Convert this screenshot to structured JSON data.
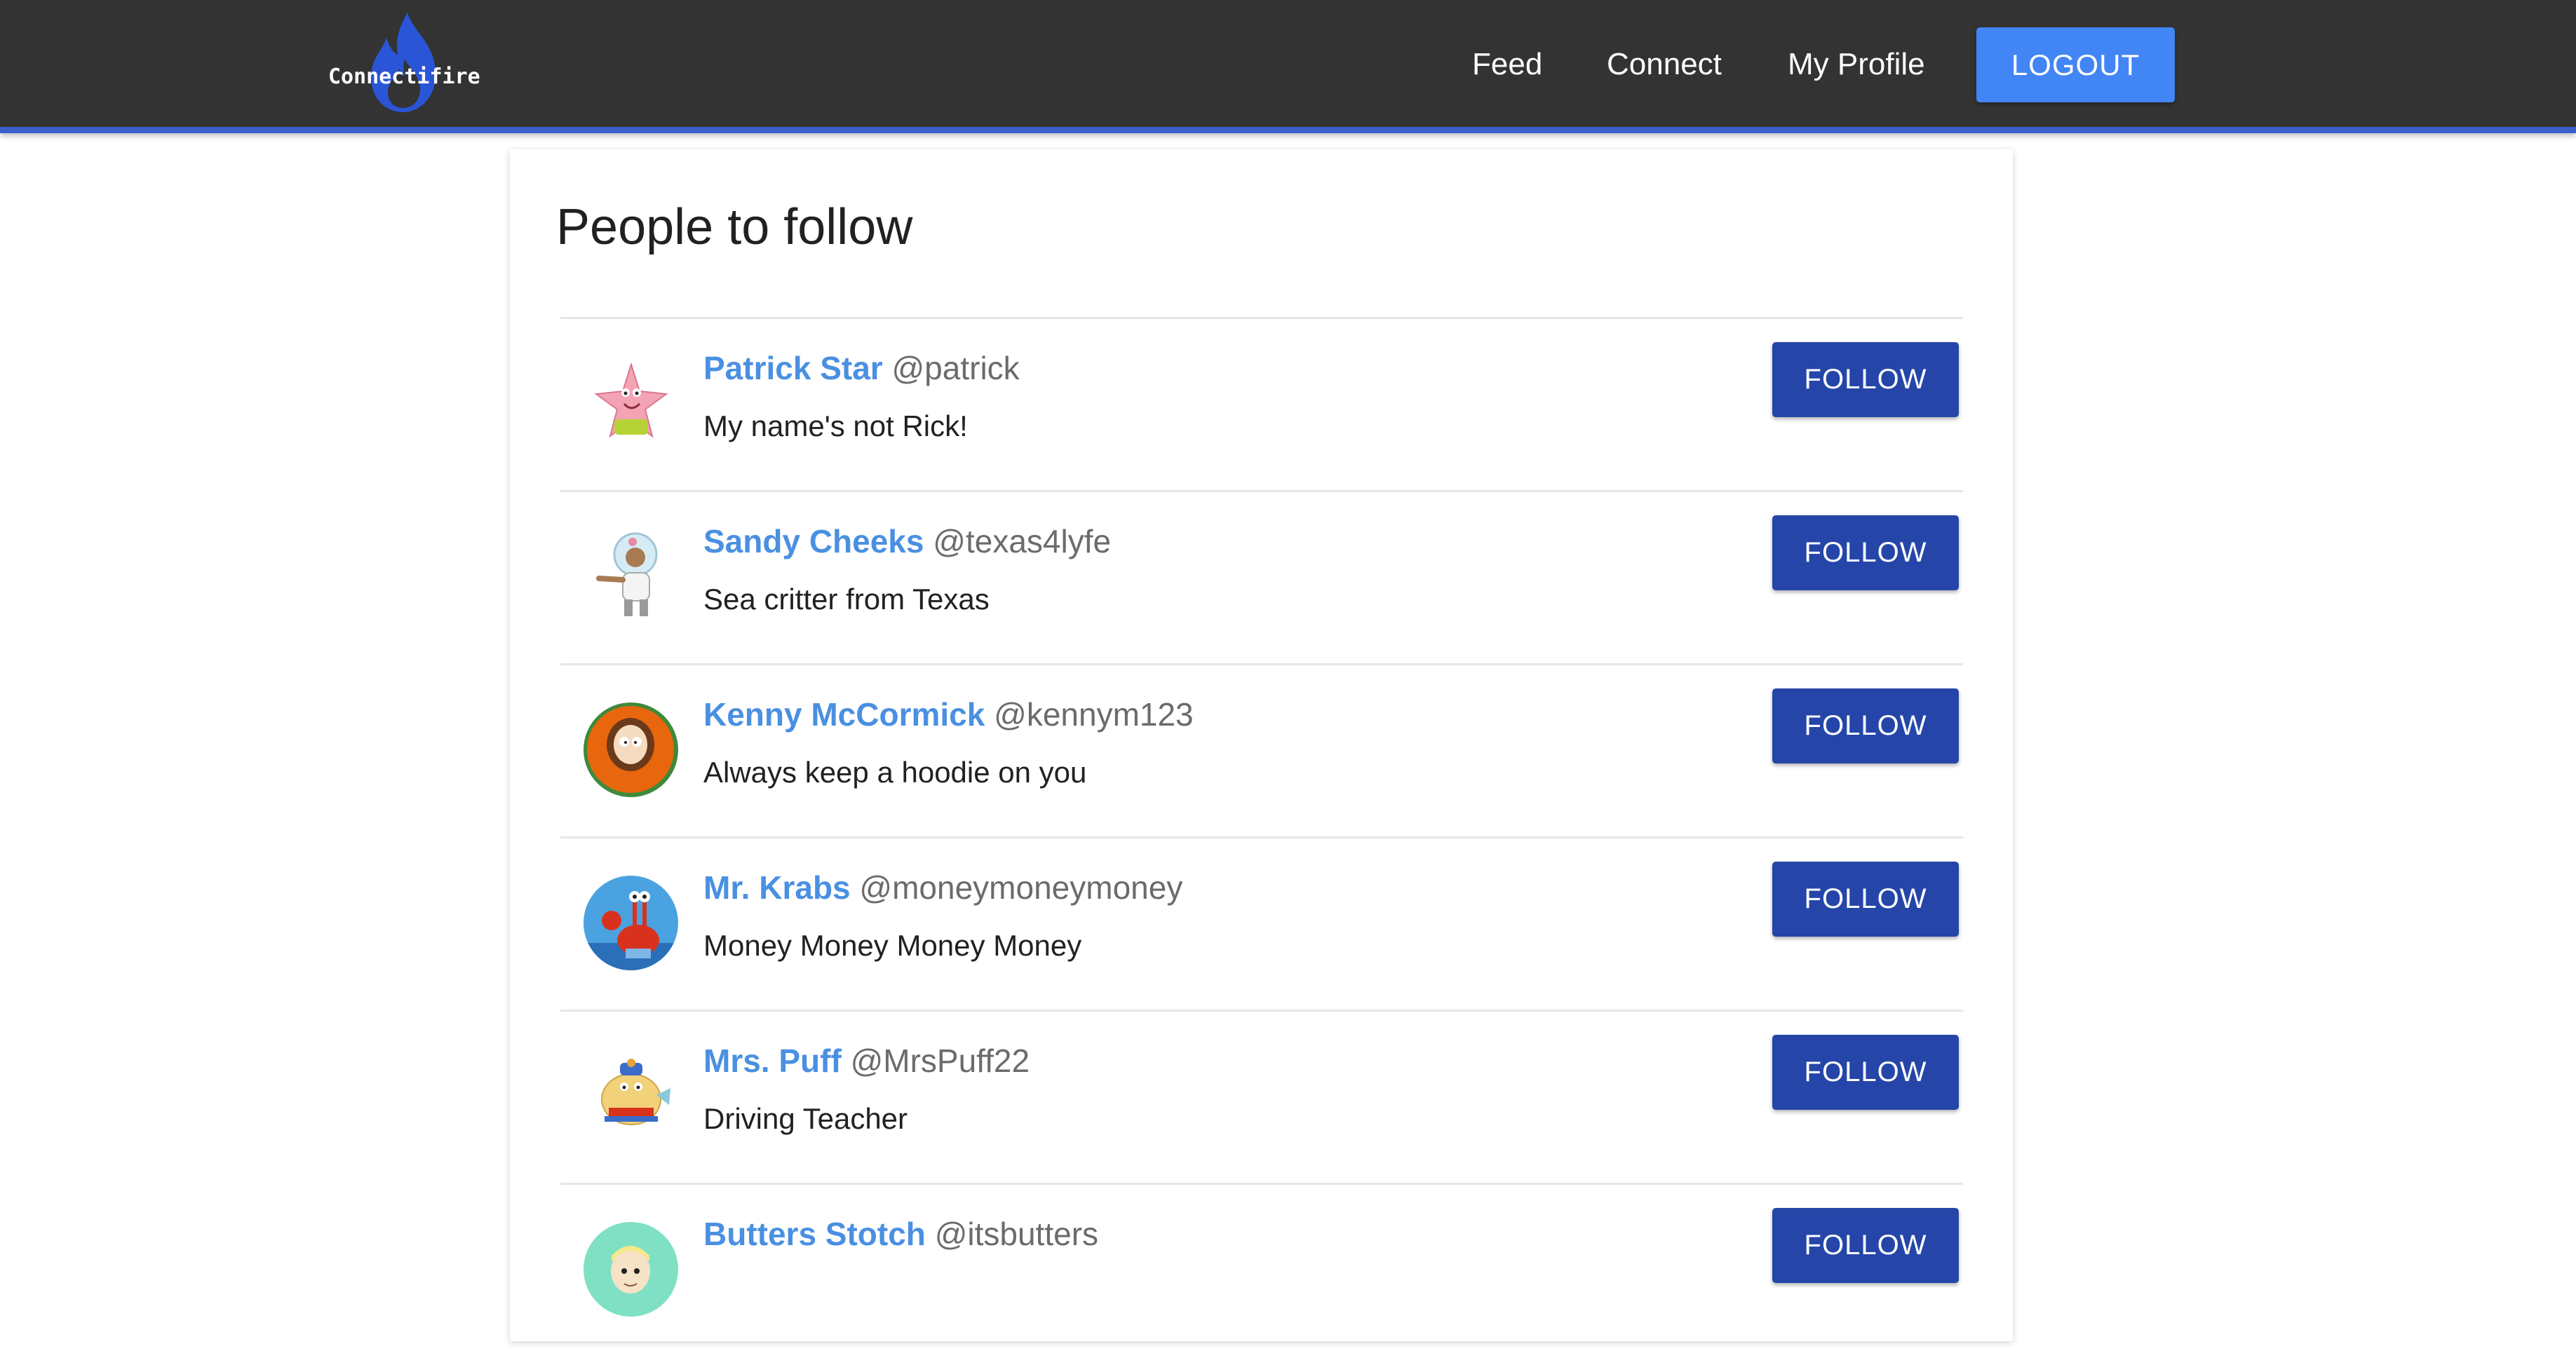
{
  "navbar": {
    "logo_text": "Connectifire",
    "links": [
      "Feed",
      "Connect",
      "My Profile"
    ],
    "logout_label": "LOGOUT",
    "colors": {
      "background": "#333333",
      "accent_border": "#3b5fcb",
      "logout": "#4285f4"
    }
  },
  "main": {
    "title": "People to follow",
    "follow_label": "FOLLOW",
    "users": [
      {
        "name": "Patrick Star",
        "handle": "@patrick",
        "bio": "My name's not Rick!",
        "avatar": "patrick-star-icon"
      },
      {
        "name": "Sandy Cheeks",
        "handle": "@texas4lyfe",
        "bio": "Sea critter from Texas",
        "avatar": "sandy-cheeks-icon"
      },
      {
        "name": "Kenny McCormick",
        "handle": "@kennym123",
        "bio": "Always keep a hoodie on you",
        "avatar": "kenny-icon"
      },
      {
        "name": "Mr. Krabs",
        "handle": "@moneymoneymoney",
        "bio": "Money Money Money Money",
        "avatar": "mr-krabs-icon"
      },
      {
        "name": "Mrs. Puff",
        "handle": "@MrsPuff22",
        "bio": "Driving Teacher",
        "avatar": "mrs-puff-icon"
      },
      {
        "name": "Butters Stotch",
        "handle": "@itsbutters",
        "bio": "",
        "avatar": "butters-icon"
      }
    ],
    "colors": {
      "name": "#4a90e2",
      "follow_button": "#2546a8"
    }
  }
}
